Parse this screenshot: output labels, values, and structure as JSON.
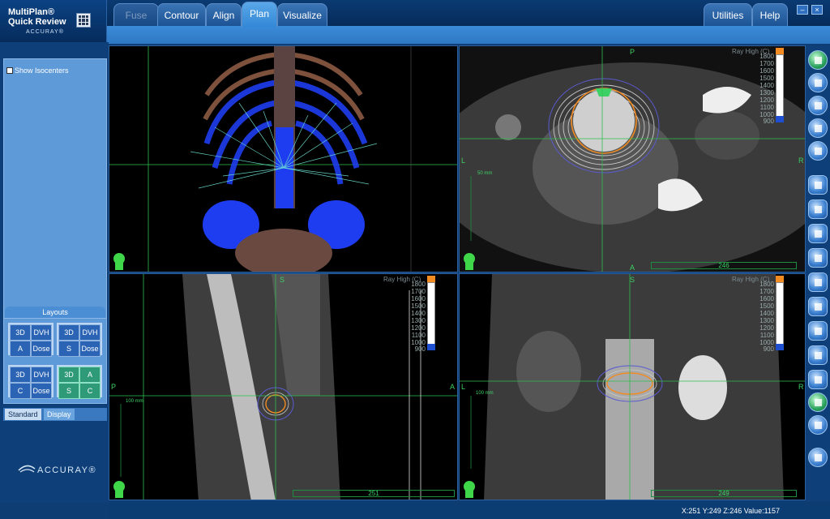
{
  "app": {
    "title_line1": "MultiPlan®",
    "title_line2": "Quick Review",
    "brand_small": "ACCURAY®"
  },
  "tabs": [
    {
      "label": "Fuse",
      "state": "disabled"
    },
    {
      "label": "Contour",
      "state": "normal"
    },
    {
      "label": "Align",
      "state": "normal"
    },
    {
      "label": "Plan",
      "state": "active"
    },
    {
      "label": "Visualize",
      "state": "normal"
    }
  ],
  "right_tabs": [
    {
      "label": "Utilities"
    },
    {
      "label": "Help"
    }
  ],
  "window_buttons": {
    "minimize": "–",
    "close": "×"
  },
  "sidebar": {
    "show_isocenters_label": "Show Isocenters",
    "layouts_title": "Layouts",
    "layouts": [
      {
        "cells": [
          "3D",
          "DVH",
          "A",
          "Dose"
        ],
        "selected": false
      },
      {
        "cells": [
          "3D",
          "DVH",
          "S",
          "Dose"
        ],
        "selected": false
      },
      {
        "cells": [
          "3D",
          "DVH",
          "C",
          "Dose"
        ],
        "selected": false
      },
      {
        "cells": [
          "3D",
          "A",
          "S",
          "C"
        ],
        "selected": true
      }
    ],
    "subtabs": [
      "Standard",
      "Display"
    ],
    "brand": "ACCURAY®"
  },
  "viewports": {
    "axial": {
      "top_label": "P",
      "left_label": "L",
      "right_label": "R",
      "bottom_label": "A",
      "ray_label": "Ray High (C)",
      "scale_values": [
        "1800",
        "1700",
        "1600",
        "1500",
        "1400",
        "1300",
        "1200",
        "1100",
        "1000",
        "900"
      ],
      "ruler_value": "246",
      "mm_label": "50 mm"
    },
    "sagittal": {
      "top_label": "S",
      "left_label": "P",
      "right_label": "A",
      "ray_label": "Ray High (C)",
      "scale_values": [
        "1800",
        "1700",
        "1600",
        "1500",
        "1400",
        "1300",
        "1200",
        "1100",
        "1000",
        "900"
      ],
      "ruler_value": "251",
      "mm_label": "100 mm"
    },
    "coronal": {
      "top_label": "S",
      "left_label": "L",
      "right_label": "R",
      "ray_label": "Ray High (C)",
      "scale_values": [
        "1800",
        "1700",
        "1600",
        "1500",
        "1400",
        "1300",
        "1200",
        "1100",
        "1000",
        "900"
      ],
      "ruler_value": "249",
      "mm_label": "100 mm"
    }
  },
  "status": {
    "text": "X:251  Y:249  Z:246   Value:1157"
  },
  "colors": {
    "accent": "#3287d6",
    "dose_orange": "#f28b22",
    "crosshair": "#2fbf4f"
  }
}
